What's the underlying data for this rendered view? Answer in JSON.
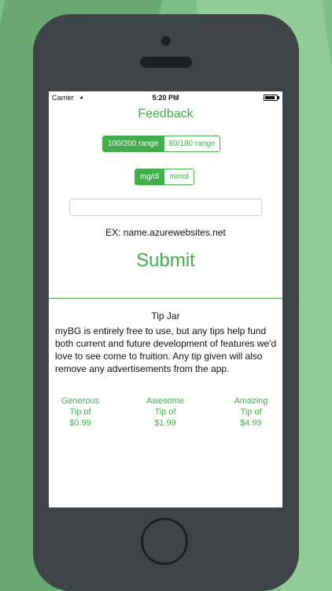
{
  "status_bar": {
    "carrier": "Carrier",
    "wifi_icon": "wifi-icon",
    "time": "5:20 PM",
    "battery_icon": "battery-icon"
  },
  "page_title": "Feedback",
  "range_segment": {
    "options": [
      "100/200 range",
      "80/180 range"
    ],
    "selected": "100/200 range"
  },
  "unit_segment": {
    "options": [
      "mg/dl",
      "mmol"
    ],
    "selected": "mg/dl"
  },
  "url_input": {
    "value": "",
    "placeholder": ""
  },
  "example_text": "EX: name.azurewebsites.net",
  "submit_label": "Submit",
  "tip_jar": {
    "title": "Tip Jar",
    "description": "myBG is entirely free to use, but any tips help fund both current and future development of features we'd love to see come to fruition. Any tip given will also remove any advertisements from the app.",
    "tips": [
      {
        "label": "Generous",
        "line2": "Tip of",
        "price": "$0.99"
      },
      {
        "label": "Awesome",
        "line2": "Tip of",
        "price": "$1.99"
      },
      {
        "label": "Amazing",
        "line2": "Tip of",
        "price": "$4.99"
      }
    ]
  },
  "colors": {
    "accent": "#3fae4b",
    "background": "#7cbf87",
    "phone_body": "#3f4449"
  }
}
